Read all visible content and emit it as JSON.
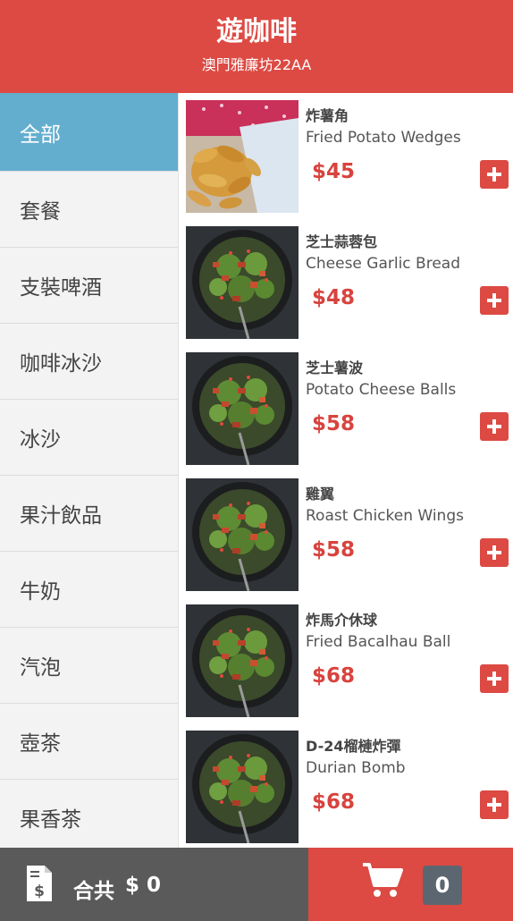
{
  "header": {
    "title": "遊咖啡",
    "subtitle": "澳門雅廉坊22AA"
  },
  "categories": [
    {
      "label": "全部",
      "active": true
    },
    {
      "label": "套餐"
    },
    {
      "label": "支裝啤酒"
    },
    {
      "label": "咖啡冰沙"
    },
    {
      "label": "冰沙"
    },
    {
      "label": "果汁飲品"
    },
    {
      "label": "牛奶"
    },
    {
      "label": "汽泡"
    },
    {
      "label": "壺茶"
    },
    {
      "label": "果香茶"
    }
  ],
  "items": [
    {
      "name_zh": "炸薯角",
      "name_en": "Fried Potato Wedges",
      "price": "$45",
      "image": "potato-wedges-photo"
    },
    {
      "name_zh": "芝士蒜蓉包",
      "name_en": "Cheese Garlic Bread",
      "price": "$48",
      "image": "salad-bowl-photo"
    },
    {
      "name_zh": "芝士薯波",
      "name_en": "Potato Cheese Balls",
      "price": "$58",
      "image": "salad-bowl-photo"
    },
    {
      "name_zh": "雞翼",
      "name_en": "Roast Chicken Wings",
      "price": "$58",
      "image": "salad-bowl-photo"
    },
    {
      "name_zh": "炸馬介休球",
      "name_en": "Fried Bacalhau Ball",
      "price": "$68",
      "image": "salad-bowl-photo"
    },
    {
      "name_zh": "D-24榴槤炸彈",
      "name_en": "Durian Bomb",
      "price": "$68",
      "image": "salad-bowl-photo"
    }
  ],
  "footer": {
    "total_label": "合共",
    "total_amount": "$ 0",
    "cart_count": "0"
  },
  "colors": {
    "brand_red": "#dc4a43",
    "active_blue": "#63aecf",
    "footer_gray": "#5a5a5a"
  }
}
